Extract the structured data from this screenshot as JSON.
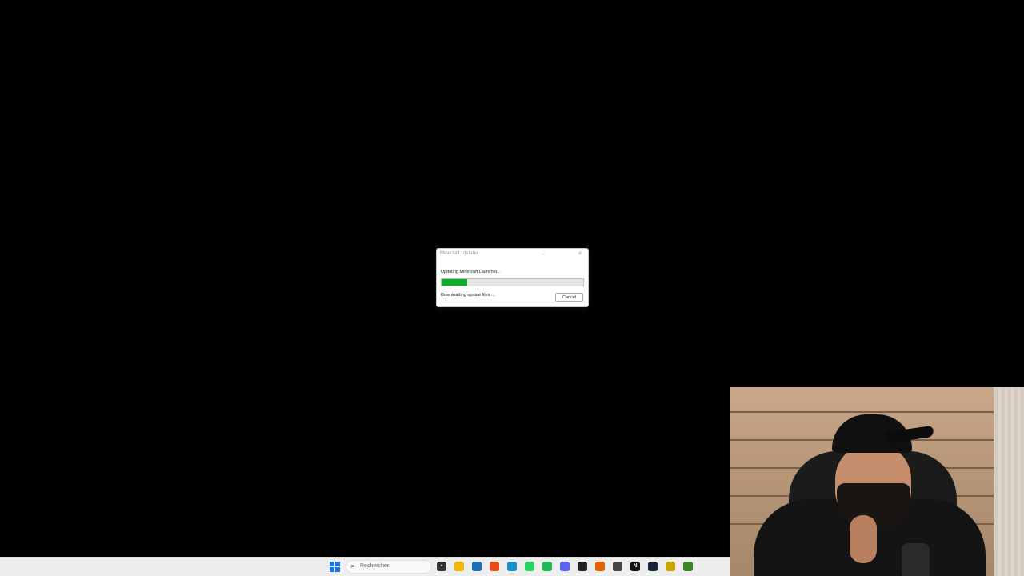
{
  "dialog": {
    "title": "Minecraft Updater",
    "minimize_glyph": "–",
    "close_glyph": "✕",
    "status": "Updating Minecraft Launcher...",
    "progress_percent": 18,
    "sub_status": "Downloading update files ...",
    "cancel_label": "Cancel",
    "progress_color": "#06b025"
  },
  "taskbar": {
    "search_placeholder": "Rechercher",
    "search_icon_glyph": "⌕",
    "icons": [
      {
        "name": "task-view-icon",
        "color": "#333333",
        "glyph": "▪"
      },
      {
        "name": "file-explorer-icon",
        "color": "#f2b600",
        "glyph": ""
      },
      {
        "name": "store-icon",
        "color": "#1e6fb8",
        "glyph": ""
      },
      {
        "name": "brave-icon",
        "color": "#e8491d",
        "glyph": ""
      },
      {
        "name": "edge-icon",
        "color": "#1b8fc9",
        "glyph": ""
      },
      {
        "name": "whatsapp-icon",
        "color": "#25d366",
        "glyph": ""
      },
      {
        "name": "spotify-icon",
        "color": "#1db954",
        "glyph": ""
      },
      {
        "name": "discord-icon",
        "color": "#5865f2",
        "glyph": ""
      },
      {
        "name": "app-dark-red-icon",
        "color": "#222222",
        "glyph": ""
      },
      {
        "name": "firefox-icon",
        "color": "#e66000",
        "glyph": ""
      },
      {
        "name": "app-yellow-icon",
        "color": "#444444",
        "glyph": ""
      },
      {
        "name": "notion-icon",
        "color": "#111111",
        "glyph": "N"
      },
      {
        "name": "steam-icon",
        "color": "#1b2838",
        "glyph": ""
      },
      {
        "name": "app-gold-icon",
        "color": "#c9a400",
        "glyph": ""
      },
      {
        "name": "minecraft-icon",
        "color": "#3c8527",
        "glyph": ""
      }
    ]
  }
}
